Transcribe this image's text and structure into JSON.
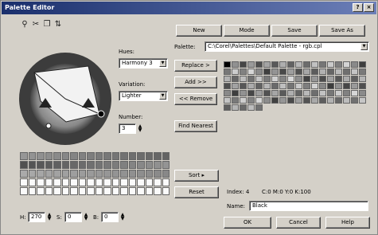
{
  "window": {
    "title": "Palette Editor",
    "btn_help": "?",
    "btn_close": "×"
  },
  "toolbar": {
    "tools": [
      "eyedropper-icon",
      "scissors-icon",
      "paste-icon",
      "sort-icon"
    ]
  },
  "top_buttons": [
    "New",
    "Mode",
    "Save",
    "Save As"
  ],
  "palette": {
    "label": "Palette:",
    "value": "C:\\Corel\\Palettes\\Default Palette - rgb.cpl"
  },
  "harmony": {
    "hues_label": "Hues:",
    "hues_value": "Harmony 3",
    "variation_label": "Variation:",
    "variation_value": "Lighter",
    "number_label": "Number:",
    "number_value": "3"
  },
  "actions": {
    "replace": "Replace >",
    "add": "Add >>",
    "remove": "<< Remove",
    "find_nearest": "Find Nearest"
  },
  "bottom_controls": {
    "sort": "Sort",
    "reset": "Reset",
    "index_label": "Index: 4",
    "color_value": "C:0 M:0 Y:0 K:100",
    "name_label": "Name:",
    "name_value": "Black",
    "ok": "OK",
    "cancel": "Cancel",
    "help": "Help"
  },
  "hsv": {
    "h_label": "H:",
    "h_value": "270",
    "s_label": "S:",
    "s_value": "0",
    "b_label": "B:",
    "b_value": "0"
  }
}
